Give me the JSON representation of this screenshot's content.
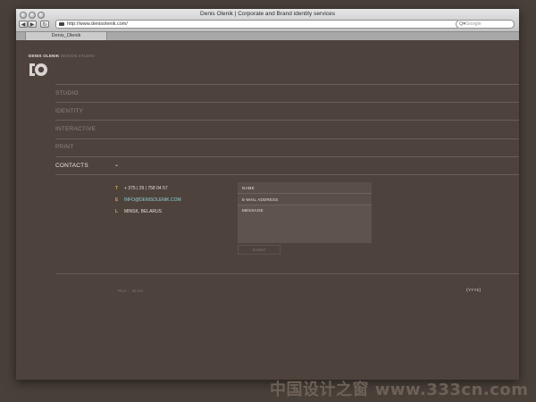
{
  "window": {
    "title": "Denis Olenik | Corporate and Brand identity services",
    "address": "http://www.denisolenik.com/",
    "search_placeholder": "Google",
    "tab_label": "Denis_Olenik",
    "back_glyph": "◀",
    "forward_glyph": "▶",
    "reload_glyph": "↻",
    "search_glyph": "Q▾"
  },
  "logo": {
    "name": "DENIS OLENIK",
    "studio": "DESIGN STUDIO"
  },
  "nav": [
    {
      "label": "STUDIO",
      "active": false
    },
    {
      "label": "IDENTITY",
      "active": false
    },
    {
      "label": "INTERACTIVE",
      "active": false
    },
    {
      "label": "PRINT",
      "active": false
    },
    {
      "label": "CONTACTS",
      "active": true
    }
  ],
  "nav_chevron": "⌄",
  "contacts": [
    {
      "letter": "T",
      "value": "+ 375 | 29 | 758 04 57",
      "color": "#c9a25a"
    },
    {
      "letter": "E",
      "value": "INFO@DENISOLENIK.COM",
      "color": "#c9a25a"
    },
    {
      "letter": "L",
      "value": "MINSK, BELARUS",
      "color": "#c9a25a"
    }
  ],
  "form": {
    "name": "NAME",
    "email": "E-MAIL ADDRESS",
    "message": "MESSAGE",
    "submit": "SUBMIT"
  },
  "footer": {
    "lang": "RUS",
    "sep": "/",
    "blog": "BLOG",
    "credit": "(ʏʏʏɛ)"
  },
  "watermark": "中国设计之窗 www.333cn.com",
  "colors": {
    "page_bg": "#4d423c",
    "accent_link": "#8fd3d6",
    "accent_letter": "#c9a25a"
  }
}
